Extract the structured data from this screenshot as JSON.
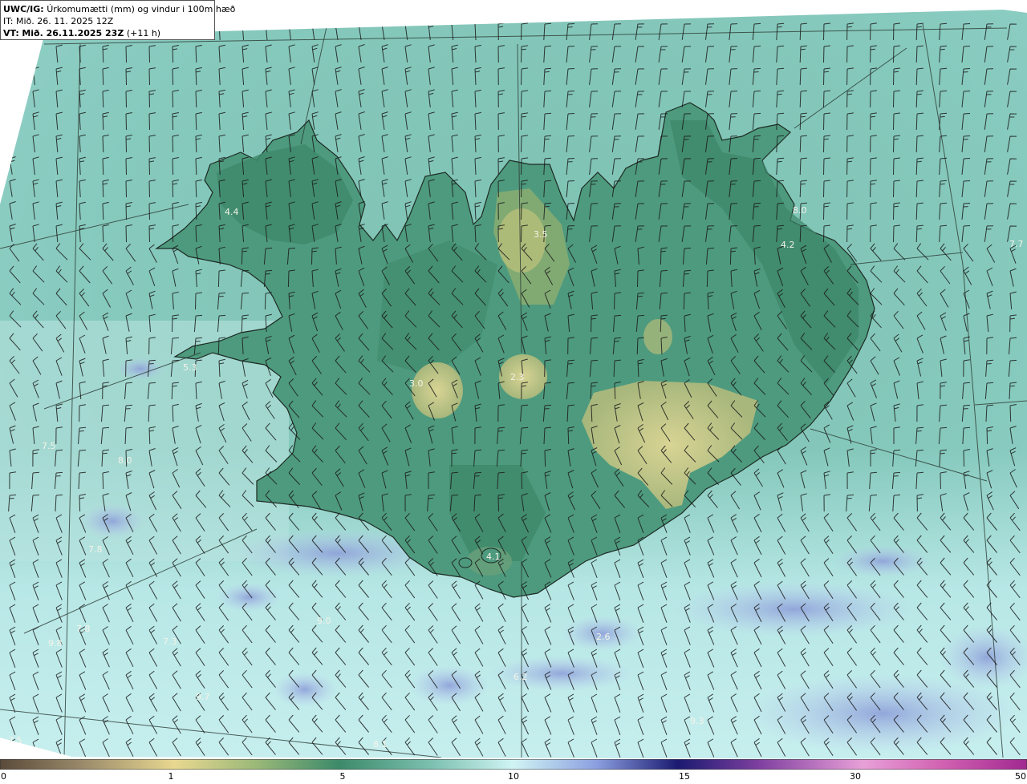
{
  "header": {
    "model": "UWC/IG:",
    "description": "Úrkomumætti (mm) og vindur i 100m hæð",
    "init_time": "IT: Mið. 26. 11. 2025 12Z",
    "valid_prefix": "VT:",
    "valid_time": "Mið. 26.11.2025 23Z",
    "valid_offset": "(+11 h)"
  },
  "colorbar": {
    "ticks": [
      "0",
      "1",
      "5",
      "10",
      "15",
      "30",
      "50"
    ]
  },
  "colors": {
    "ocean": "#7fc6ba",
    "land_low": "#4f9a80",
    "land_mid": "#3c8a6a",
    "land_high": "#c8c88a",
    "pale_sea": "#c6ecec",
    "blue_patches": "#a8b8e8"
  },
  "map_values": [
    "4.4",
    "3.5",
    "8.0",
    "4.2",
    "7.7",
    "5.3",
    "3.0",
    "2.3",
    "7.5",
    "8.0",
    "7.8",
    "4.1",
    "7.8",
    "9.8",
    "7.3",
    "9.0",
    "9.7",
    "2.6",
    "9.3",
    "7.5",
    "8.1",
    "6.2"
  ]
}
